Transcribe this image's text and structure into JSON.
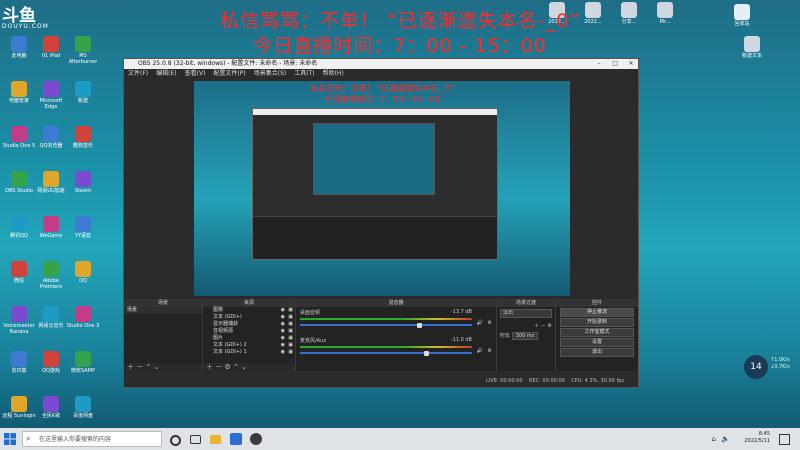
{
  "logo": {
    "brand": "斗鱼",
    "site": "DOUYU.COM"
  },
  "overlay": {
    "line1": "私信骂骂：不单！ “已逐渐遗失本名-_0”",
    "line2": "今日直播时间：7：00 - 15：00"
  },
  "desktop_icons_left": [
    "此电脑",
    "01 iPad",
    "MS Afterburner",
    "电脑管家",
    "Microsoft Edge",
    "新建",
    "Studio One 5",
    "QQ浏览器",
    "酷狗音乐",
    "OBS Studio",
    "网易UU加速",
    "Steam",
    "腾讯QQ",
    "WeGame",
    "YY语音",
    "微信",
    "Adobe Premiere",
    "QQ",
    "Voicemeeter Banana",
    "网易云音乐",
    "Studio One 3",
    "向日葵",
    "QQ游戏",
    "微软SAMP",
    "远程 Sunlogin",
    "全民K歌",
    "百度网盘"
  ],
  "desktop_icons_right": [
    "回收站",
    "2022...",
    "2022...",
    "分享...",
    "Mr...",
    "新建文本"
  ],
  "obs": {
    "title": "OBS 25.0.8 (32-bit, windows) - 配置文件: 未命名 - 场景: 未命名",
    "menu": [
      "文件(F)",
      "编辑(E)",
      "查看(V)",
      "配置文件(P)",
      "场景集合(S)",
      "工具(T)",
      "帮助(H)"
    ],
    "preview_overlay1": "私信骂骂：不单！ “已逐渐遗失本名-_0”",
    "preview_overlay2": "今日直播时间：7：00 - 15：00",
    "docks": {
      "scenes": {
        "title": "场景",
        "items": [
          "场景"
        ]
      },
      "sources": {
        "title": "来源",
        "items": [
          "图像",
          "文本 (GDI+)",
          "显示器捕获",
          "音视频源",
          "图片",
          "文本 (GDI+) 2",
          "文本 (GDI+) 1"
        ]
      },
      "mixer": {
        "title": "混音器",
        "tracks": [
          {
            "name": "桌面音频",
            "db": "-13.7 dB",
            "level": 0.68
          },
          {
            "name": "麦克风/Aux",
            "db": "-11.0 dB",
            "level": 0.72
          }
        ]
      },
      "transitions": {
        "title": "场景过渡",
        "type": "淡出",
        "duration_label": "时长",
        "duration": "300 ms"
      },
      "controls": {
        "title": "控件",
        "buttons": [
          "停止推流",
          "开始录制",
          "工作室模式",
          "设置",
          "退出"
        ]
      }
    },
    "status": {
      "live_label": "LIVE:",
      "live": "00:00:00",
      "rec_label": "REC:",
      "rec": "00:00:00",
      "cpu_label": "CPU:",
      "cpu": "4.3%, 30.00 fps"
    }
  },
  "taskbar": {
    "search_placeholder": "在这里输入你要搜索的内容",
    "time": "8:45",
    "date": "2022/5/11"
  },
  "perf": {
    "percent": "14",
    "net_up": "1.0K/s",
    "net_down": "0.7K/s"
  }
}
